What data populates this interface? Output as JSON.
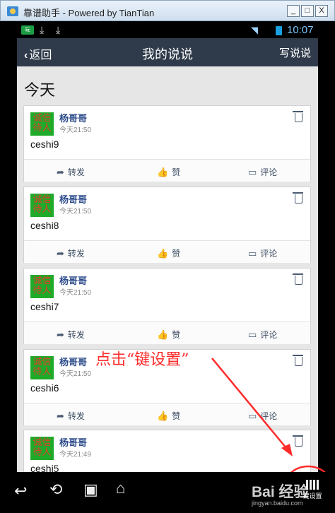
{
  "window": {
    "title": "靠谱助手 - Powered by TianTian",
    "min": "_",
    "max": "□",
    "close": "X"
  },
  "statusbar": {
    "time": "10:07",
    "app_badge": "玩"
  },
  "appbar": {
    "back_label": "返回",
    "title": "我的说说",
    "write_label": "写说说"
  },
  "section_title": "今天",
  "avatar_text": "诚信待人",
  "posts": [
    {
      "author": "杨哥哥",
      "time": "今天21:50",
      "text": "ceshi9"
    },
    {
      "author": "杨哥哥",
      "time": "今天21:50",
      "text": "ceshi8"
    },
    {
      "author": "杨哥哥",
      "time": "今天21:50",
      "text": "ceshi7"
    },
    {
      "author": "杨哥哥",
      "time": "今天21:50",
      "text": "ceshi6"
    },
    {
      "author": "杨哥哥",
      "time": "今天21:49",
      "text": "ceshi5"
    }
  ],
  "actions": {
    "forward": "转发",
    "like": "赞",
    "comment": "评论"
  },
  "annotation": "点击“键设置”",
  "navbar": {
    "key_settings": "键设置"
  },
  "watermark": {
    "logo": "Bai  经验",
    "url": "jingyan.baidu.com"
  }
}
